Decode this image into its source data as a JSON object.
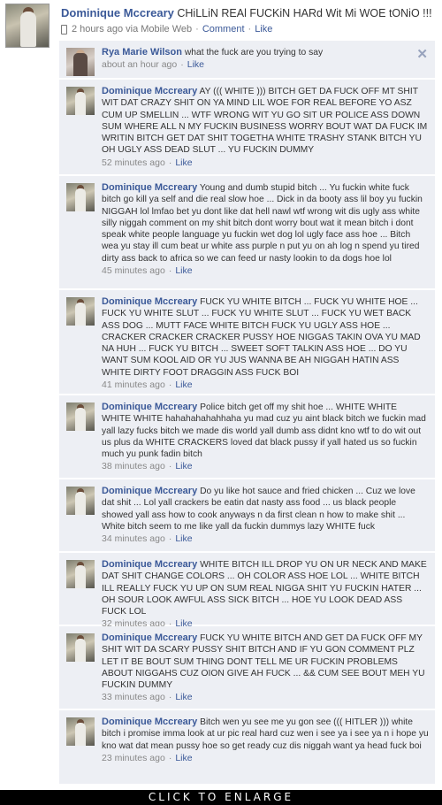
{
  "post": {
    "author": "Dominique Mccreary",
    "text": "CHiLLiN REAl FUCKiN HARd Wit Mi WOE tONiO !!!",
    "time": "2 hours ago via Mobile Web",
    "comment_link": "Comment",
    "like_link": "Like",
    "separator": "·"
  },
  "comments": [
    {
      "author": "Rya Marie Wilson",
      "text": "what the fuck are you trying to say",
      "time": "about an hour ago",
      "like": "Like"
    },
    {
      "author": "Dominique Mccreary",
      "text": "AY ((( WHITE ))) BITCH GET DA FUCK OFF MT SHIT WIT DAT CRAZY SHIT ON YA MIND LIL WOE FOR REAL BEFORE YO ASZ CUM UP SMELLIN ... WTF WRONG WIT YU GO SIT UR POLICE ASS DOWN SUM WHERE ALL N MY FUCKIN BUSINESS WORRY BOUT WAT DA FUCK IM WRITIN BITCH GET DAT SHIT TOGETHA WHITE TRASHY STANK BITCH YU OH UGLY ASS DEAD SLUT ... YU FUCKIN DUMMY",
      "time": "52 minutes ago",
      "like": "Like"
    },
    {
      "author": "Dominique Mccreary",
      "text": "Young and dumb stupid bitch ... Yu fuckin white fuck bitch go kill ya self and die real slow hoe ... Dick in da booty ass lil boy yu fuckin NIGGAH lol lmfao bet yu dont like dat hell nawl wtf wrong wit dis ugly ass white silly niggah comment on my shit bitch dont worry bout wat it mean bitch i dont speak white people language yu fuckin wet dog lol ugly face ass hoe ... Bitch wea yu stay ill cum beat ur white ass purple n put yu on ah log n spend yu tired dirty ass back to africa so we can feed ur nasty lookin to da dogs hoe lol",
      "time": "45 minutes ago",
      "like": "Like"
    },
    {
      "author": "Dominique Mccreary",
      "text": "FUCK YU WHITE BITCH ... FUCK YU WHITE HOE ... FUCK YU WHITE SLUT ... FUCK YU WHITE SLUT ... FUCK YU WET BACK ASS DOG ... MUTT FACE WHITE BITCH FUCK YU UGLY ASS HOE ... CRACKER CRACKER CRACKER PUSSY HOE NIGGAS TAKIN OVA YU MAD NA HUH ... FUCK YU BITCH ... SWEET SOFT TALKIN ASS HOE ... DO YU WANT SUM KOOL AID OR YU JUS WANNA BE AH NIGGAH HATIN ASS WHITE DIRTY FOOT DRAGGIN ASS FUCK BOI",
      "time": "41 minutes ago",
      "like": "Like"
    },
    {
      "author": "Dominique Mccreary",
      "text": "Police bitch get off my shit hoe ... WHITE WHITE WHITE WHITE hahahahahahhaha yu mad cuz yu aint black bitch we fuckin mad yall lazy fucks bitch we made dis world yall dumb ass didnt kno wtf to do wit out us plus da WHITE CRACKERS loved dat black pussy if yall hated us so fuckin much yu punk fadin bitch",
      "time": "38 minutes ago",
      "like": "Like"
    },
    {
      "author": "Dominique Mccreary",
      "text": "Do yu like hot sauce and fried chicken ... Cuz we love dat shit ... Lol yall crackers be eatin dat nasty ass food ... us black people showed yall ass how to cook anyways n da first clean n how to make shit ... White bitch seem to me like yall da fuckin dummys lazy WHITE fuck",
      "time": "34 minutes ago",
      "like": "Like"
    },
    {
      "author": "Dominique Mccreary",
      "text": "WHITE BITCH ILL DROP YU ON UR NECK AND MAKE DAT SHIT CHANGE COLORS ... OH COLOR ASS HOE LOL ... WHITE BITCH ILL REALLY FUCK YU UP ON SUM REAL NIGGA SHIT YU FUCKIN HATER ... OH SOUR LOOK AWFUL ASS SICK BITCH ... HOE YU LOOK DEAD ASS FUCK LOL",
      "time": "32 minutes ago",
      "like": "Like"
    },
    {
      "author": "Dominique Mccreary",
      "text": "FUCK YU WHITE BITCH AND GET DA FUCK OFF MY SHIT WIT DA SCARY PUSSY SHIT BITCH AND IF YU GON COMMENT PLZ LET IT BE BOUT SUM THING DONT TELL ME UR FUCKIN PROBLEMS ABOUT NIGGAHS CUZ OION GIVE AH FUCK ... && CUM SEE BOUT MEH YU FUCKIN DUMMY",
      "time": "33 minutes ago",
      "like": "Like"
    },
    {
      "author": "Dominique Mccreary",
      "text": "Bitch wen yu see me yu gon see ((( HITLER ))) white bitch i promise imma look at ur pic real hard cuz wen i see ya i see ya n i hope yu kno wat dat mean pussy hoe so get ready cuz dis niggah want ya head fuck boi",
      "time": "23 minutes ago",
      "like": "Like"
    }
  ],
  "footer": {
    "label": "CLICK TO ENLARGE"
  },
  "icons": {
    "close": "close-icon",
    "mobile": "mobile-phone-icon"
  },
  "colors": {
    "link": "#3b5998",
    "comment_bg": "#edeff4",
    "footer_bg": "#000000"
  }
}
